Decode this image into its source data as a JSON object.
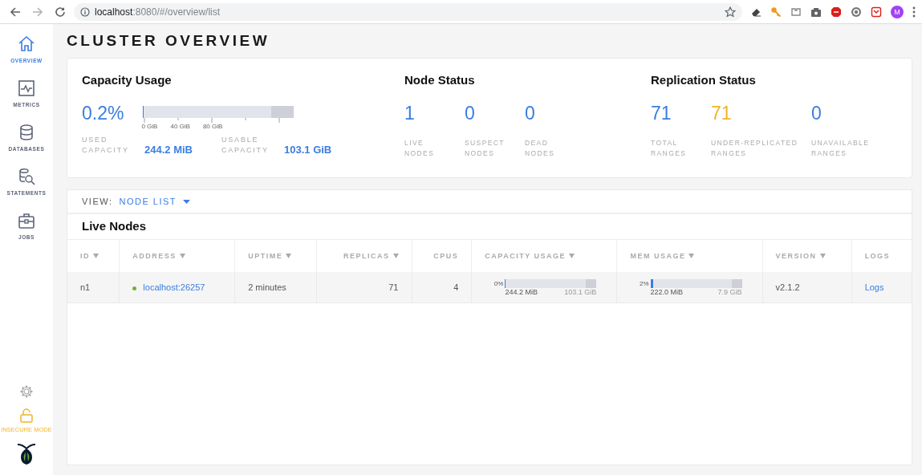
{
  "browser": {
    "url_host": "localhost",
    "url_rest": ":8080/#/overview/list",
    "avatar": "M"
  },
  "sidebar": {
    "items": [
      {
        "label": "OVERVIEW",
        "selected": true
      },
      {
        "label": "METRICS",
        "selected": false
      },
      {
        "label": "DATABASES",
        "selected": false
      },
      {
        "label": "STATEMENTS",
        "selected": false
      },
      {
        "label": "JOBS",
        "selected": false
      }
    ],
    "mode": "INSECURE MODE"
  },
  "page_title": "CLUSTER OVERVIEW",
  "capacity": {
    "title": "Capacity Usage",
    "percent": "0.2%",
    "level": 0.002,
    "ticks": [
      "0 GiB",
      "40 GiB",
      "80 GiB"
    ],
    "stats": [
      {
        "label": "USED CAPACITY",
        "value": "244.2 MiB"
      },
      {
        "label": "USABLE CAPACITY",
        "value": "103.1 GiB"
      }
    ]
  },
  "status_groups": [
    {
      "title": "Node Status",
      "metrics": [
        {
          "value": "1",
          "label": "LIVE NODES",
          "color": "#3a7de1"
        },
        {
          "value": "0",
          "label": "SUSPECT NODES",
          "color": "#3a7de1"
        },
        {
          "value": "0",
          "label": "DEAD NODES",
          "color": "#3a7de1"
        }
      ]
    },
    {
      "title": "Replication Status",
      "metrics": [
        {
          "value": "71",
          "label": "TOTAL RANGES",
          "color": "#3a7de1"
        },
        {
          "value": "71",
          "label": "UNDER-REPLICATED RANGES",
          "color": "#f0b429"
        },
        {
          "value": "0",
          "label": "UNAVAILABLE RANGES",
          "color": "#3a7de1"
        }
      ]
    }
  ],
  "view": {
    "label": "VIEW:",
    "value": "NODE LIST"
  },
  "table": {
    "title": "Live Nodes",
    "columns": [
      {
        "label": "ID",
        "sortable": true
      },
      {
        "label": "ADDRESS",
        "sortable": true
      },
      {
        "label": "UPTIME",
        "sortable": true
      },
      {
        "label": "REPLICAS",
        "sortable": true
      },
      {
        "label": "CPUS",
        "sortable": false
      },
      {
        "label": "CAPACITY USAGE",
        "sortable": true
      },
      {
        "label": "MEM USAGE",
        "sortable": true
      },
      {
        "label": "VERSION",
        "sortable": true
      },
      {
        "label": "LOGS",
        "sortable": false
      }
    ],
    "rows": [
      {
        "id": "n1",
        "address": "localhost:26257",
        "color": "#6cb33f",
        "uptime": "2 minutes",
        "replicas": "71",
        "cpus": "4",
        "capacity": {
          "percent": "0%",
          "level": 0.002,
          "used": "244.2 MiB",
          "total": "103.1 GiB"
        },
        "mem": {
          "percent": "2%",
          "level": 0.03,
          "used": "222.0 MiB",
          "total": "7.9 GiB"
        },
        "version": "v2.1.2",
        "logs": "Logs"
      }
    ]
  }
}
